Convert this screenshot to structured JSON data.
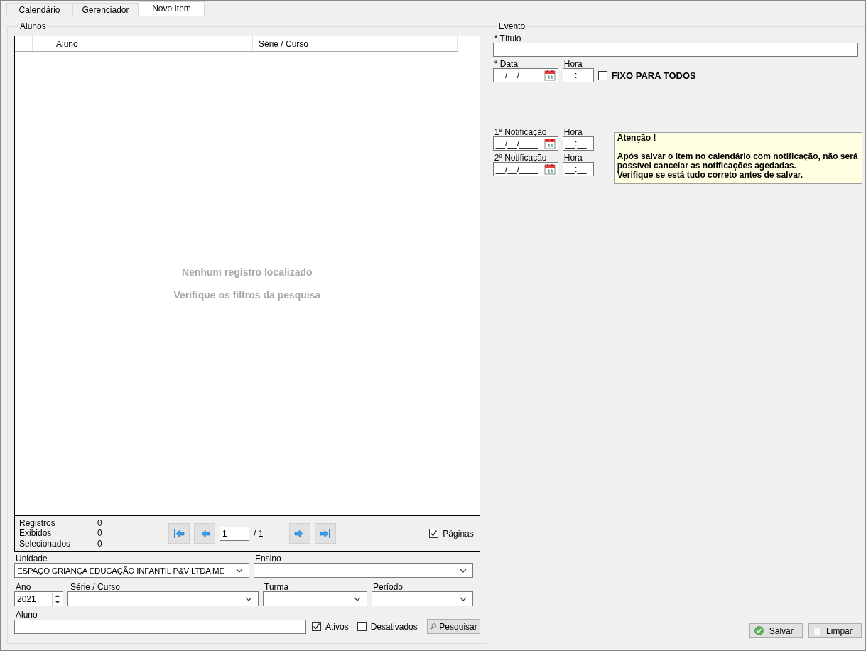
{
  "tabs": [
    {
      "label": "Calendário",
      "selected": false
    },
    {
      "label": "Gerenciador",
      "selected": false
    },
    {
      "label": "Novo Item",
      "selected": true
    }
  ],
  "alunos": {
    "title": "Alunos",
    "grid": {
      "columns": [
        "Aluno",
        "Série / Curso"
      ],
      "empty_message": [
        "Nenhum registro localizado",
        "Verifique os filtros da pesquisa"
      ]
    },
    "stats": [
      {
        "label": "Registros",
        "value": "0"
      },
      {
        "label": "Exibidos",
        "value": "0"
      },
      {
        "label": "Selecionados",
        "value": "0"
      }
    ],
    "pager": {
      "page": "1",
      "total": "/ 1"
    },
    "paginas": {
      "label": "Páginas",
      "checked": true
    },
    "unidade": {
      "label": "Unidade",
      "value": "ESPAÇO CRIANÇA EDUCAÇÃO INFANTIL P&V LTDA ME"
    },
    "ensino": {
      "label": "Ensino"
    },
    "ano": {
      "label": "Ano",
      "value": "2021"
    },
    "serie": {
      "label": "Série / Curso"
    },
    "turma": {
      "label": "Turma"
    },
    "periodo": {
      "label": "Período"
    },
    "aluno": {
      "label": "Aluno"
    },
    "ativos": {
      "label": "Ativos",
      "checked": true
    },
    "desativados": {
      "label": "Desativados",
      "checked": false
    },
    "search_button": "Pesquisar"
  },
  "evento": {
    "title": "Evento",
    "titulo": {
      "label": "* Título"
    },
    "data": {
      "label": "* Data",
      "value": "__/__/____"
    },
    "hora": {
      "label": "Hora",
      "value": "__:__"
    },
    "fixo": {
      "label": "FIXO PARA TODOS",
      "checked": false
    },
    "notificacoes": [
      {
        "label": "1ª Notificação",
        "value": "__/__/____",
        "hora_label": "Hora",
        "hora_value": "__:__"
      },
      {
        "label": "2ª Notificação",
        "value": "__/__/____",
        "hora_label": "Hora",
        "hora_value": "__:__"
      }
    ],
    "notice": {
      "title": "Atenção !",
      "text": "Após salvar o item no calendário com notificação, não será possível cancelar as notificações agedadas.\nVerifique se está tudo correto antes de salvar."
    },
    "buttons": [
      {
        "kind": "save",
        "label": "Salvar"
      },
      {
        "kind": "clear",
        "label": "Limpar"
      }
    ]
  }
}
